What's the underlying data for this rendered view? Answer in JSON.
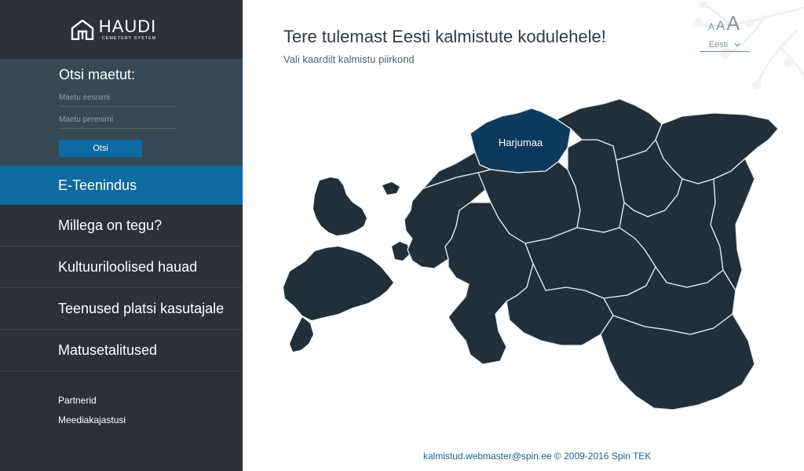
{
  "logo": {
    "name": "HAUDI",
    "subtitle": "CEMETERY SYSTEM"
  },
  "search": {
    "title": "Otsi maetut:",
    "first_name_placeholder": "Maetu eesnimi",
    "last_name_placeholder": "Maetu perenimi",
    "button_label": "Otsi"
  },
  "nav": {
    "items": [
      {
        "label": "E-Teenindus",
        "active": true
      },
      {
        "label": "Millega on tegu?"
      },
      {
        "label": "Kultuuriloolised hauad"
      },
      {
        "label": "Teenused platsi kasutajale"
      },
      {
        "label": "Matusetalitused"
      }
    ],
    "secondary": [
      {
        "label": "Partnerid"
      },
      {
        "label": "Meediakajastusi"
      }
    ]
  },
  "header": {
    "title": "Tere tulemast Eesti kalmistute kodulehele!",
    "subtitle": "Vali kaardilt kalmistu piirkond"
  },
  "font_size": {
    "small": "A",
    "medium": "A",
    "large": "A"
  },
  "language": {
    "selected": "Eesti"
  },
  "map": {
    "highlighted_region": "Harjumaa"
  },
  "footer": {
    "text": "kalmistud.webmaster@spin.ee © 2009-2016 Spin TEK"
  },
  "colors": {
    "sidebar": "#2b3137",
    "search_panel": "#374955",
    "accent": "#0f6aa2",
    "map_fill": "#232f38",
    "map_highlight": "#0c3a5d",
    "footer_link": "#1d5f91"
  }
}
